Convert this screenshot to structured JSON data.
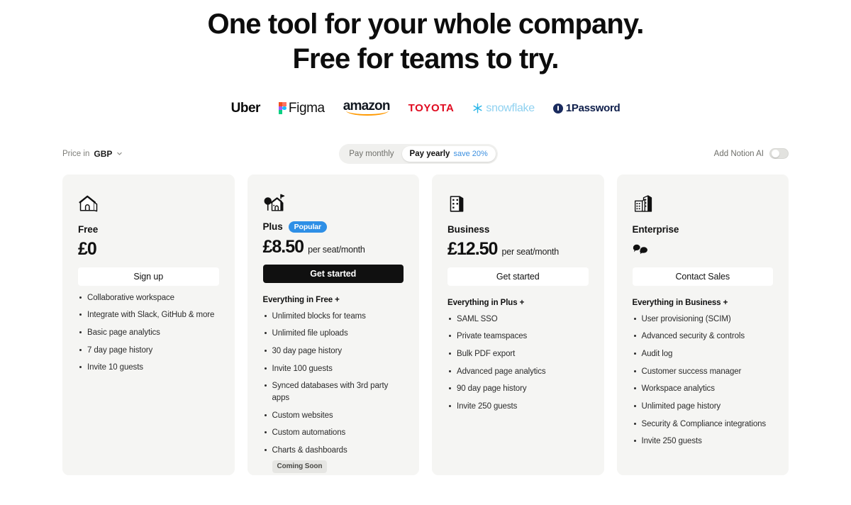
{
  "headline": {
    "line1": "One tool for your whole company.",
    "line2": "Free for teams to try."
  },
  "logos": [
    {
      "name": "Uber",
      "text": "Uber",
      "color": "#0a0a0a"
    },
    {
      "name": "Figma",
      "text": "Figma",
      "color": "#111111"
    },
    {
      "name": "amazon",
      "text": "amazon",
      "color": "#131921"
    },
    {
      "name": "TOYOTA",
      "text": "TOYOTA",
      "color": "#e00b20"
    },
    {
      "name": "snowflake",
      "text": "snowflake",
      "color": "#29b5e8"
    },
    {
      "name": "1Password",
      "text": "1Password",
      "color": "#0f1f4b"
    }
  ],
  "controls": {
    "price_in_label": "Price in",
    "currency": "GBP",
    "billing": {
      "monthly_label": "Pay monthly",
      "yearly_label": "Pay yearly",
      "save_label": "save 20%",
      "selected": "yearly",
      "save_color": "#3b8fe0"
    },
    "notion_ai": {
      "label": "Add Notion AI",
      "enabled": false
    }
  },
  "plans": [
    {
      "id": "free",
      "icon": "house-icon",
      "name": "Free",
      "badge": null,
      "price": "£0",
      "price_unit": "",
      "cta_label": "Sign up",
      "cta_style": "light",
      "features_heading": "",
      "features": [
        {
          "text": "Collaborative workspace"
        },
        {
          "text": "Integrate with Slack, GitHub & more"
        },
        {
          "text": "Basic page analytics"
        },
        {
          "text": "7 day page history"
        },
        {
          "text": "Invite 10 guests"
        }
      ]
    },
    {
      "id": "plus",
      "icon": "house-tree-icon",
      "name": "Plus",
      "badge": "Popular",
      "badge_color": "#2e8fe6",
      "price": "£8.50",
      "price_unit": "per seat/month",
      "cta_label": "Get started",
      "cta_style": "dark",
      "features_heading": "Everything in Free +",
      "features": [
        {
          "text": "Unlimited blocks for teams"
        },
        {
          "text": "Unlimited file uploads"
        },
        {
          "text": "30 day page history"
        },
        {
          "text": "Invite 100 guests"
        },
        {
          "text": "Synced databases with 3rd party apps"
        },
        {
          "text": "Custom websites"
        },
        {
          "text": "Custom automations"
        },
        {
          "text": "Charts & dashboards",
          "tag": "Coming Soon"
        }
      ]
    },
    {
      "id": "business",
      "icon": "office-icon",
      "name": "Business",
      "badge": null,
      "price": "£12.50",
      "price_unit": "per seat/month",
      "cta_label": "Get started",
      "cta_style": "light",
      "features_heading": "Everything in Plus +",
      "features": [
        {
          "text": "SAML SSO"
        },
        {
          "text": "Private teamspaces"
        },
        {
          "text": "Bulk PDF export"
        },
        {
          "text": "Advanced page analytics"
        },
        {
          "text": "90 day page history"
        },
        {
          "text": "Invite 250 guests"
        }
      ]
    },
    {
      "id": "enterprise",
      "icon": "buildings-icon",
      "name": "Enterprise",
      "badge": null,
      "price": null,
      "price_icon": "speech-bubbles-icon",
      "price_unit": "",
      "cta_label": "Contact Sales",
      "cta_style": "light",
      "features_heading": "Everything in Business +",
      "features": [
        {
          "text": "User provisioning (SCIM)"
        },
        {
          "text": "Advanced security & controls"
        },
        {
          "text": "Audit log"
        },
        {
          "text": "Customer success manager"
        },
        {
          "text": "Workspace analytics"
        },
        {
          "text": "Unlimited page history"
        },
        {
          "text": "Security & Compliance integrations"
        },
        {
          "text": "Invite 250 guests"
        }
      ]
    }
  ]
}
